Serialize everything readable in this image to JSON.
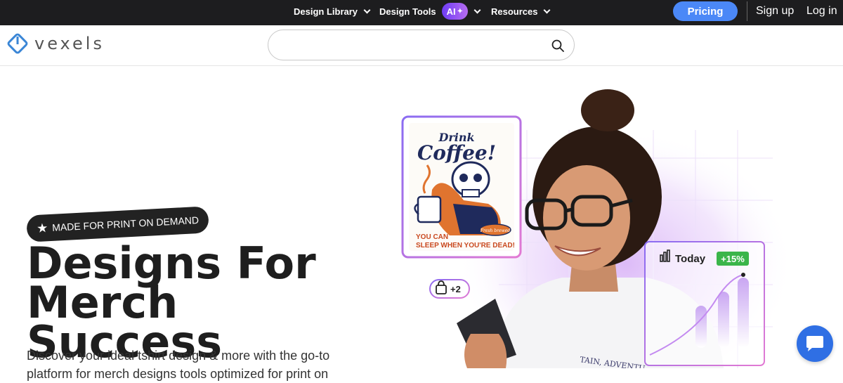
{
  "topnav": {
    "design_library": "Design Library",
    "design_tools": "Design Tools",
    "ai_badge": "AI",
    "resources": "Resources",
    "pricing": "Pricing",
    "sign_up": "Sign up",
    "log_in": "Log in"
  },
  "header": {
    "logo_text": "vexels",
    "search_placeholder": ""
  },
  "hero": {
    "badge": "MADE FOR PRINT ON DEMAND",
    "title_line1": "Designs For Merch",
    "title_line2": "Success",
    "subtitle": "Discover your ideal tshirt design & more with the go-to platform for merch designs tools optimized for print on"
  },
  "artwork": {
    "coffee_title_1": "Drink",
    "coffee_title_2": "Coffee!",
    "coffee_tagline_1": "YOU CAN",
    "coffee_tagline_2": "SLEEP WHEN YOU'RE DEAD!",
    "coffee_small_label": "Fresh brewed",
    "cart_count": "+2",
    "stats_label": "Today",
    "stats_change": "+15%",
    "shirt_text": "TAIN, ADVENTU"
  },
  "colors": {
    "topbar_bg": "#1d1d1f",
    "pricing_blue": "#4b88f7",
    "ai_gradient_start": "#6e3cf5",
    "ai_gradient_end": "#b66df0",
    "stats_green": "#3bb54a",
    "chat_blue": "#2f6fe4"
  }
}
